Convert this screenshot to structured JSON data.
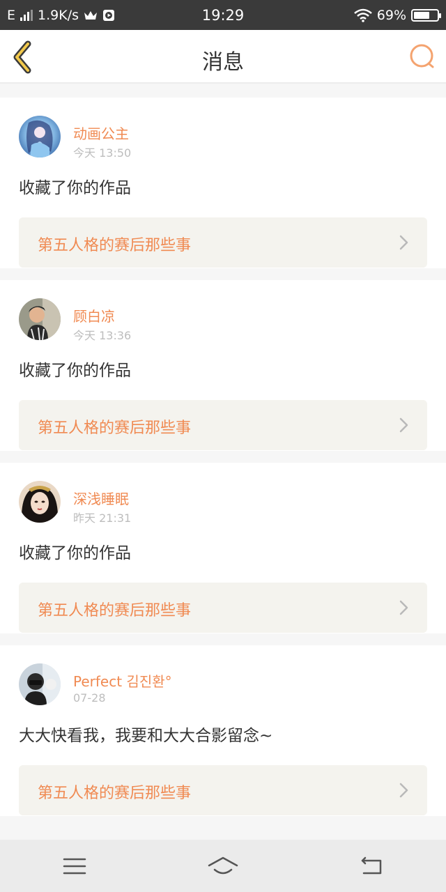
{
  "status_bar": {
    "network_type": "E",
    "speed": "1.9K/s",
    "time": "19:29",
    "battery_percent": "69%",
    "battery_level": 0.69
  },
  "header": {
    "title": "消息",
    "accent_color": "#f08a52"
  },
  "notifications": [
    {
      "username": "动画公主",
      "time": "今天 13:50",
      "action": "收藏了你的作品",
      "work_title": "第五人格的赛后那些事"
    },
    {
      "username": "顾白凉",
      "time": "今天 13:36",
      "action": "收藏了你的作品",
      "work_title": "第五人格的赛后那些事"
    },
    {
      "username": "深浅睡眠",
      "time": "昨天 21:31",
      "action": "收藏了你的作品",
      "work_title": "第五人格的赛后那些事"
    },
    {
      "username": "Perfect 김진환°",
      "time": "07-28",
      "action": "大大快看我，我要和大大合影留念~",
      "work_title": "第五人格的赛后那些事"
    }
  ],
  "nav": {
    "icons": [
      "menu-icon",
      "home-icon",
      "back-icon"
    ]
  }
}
